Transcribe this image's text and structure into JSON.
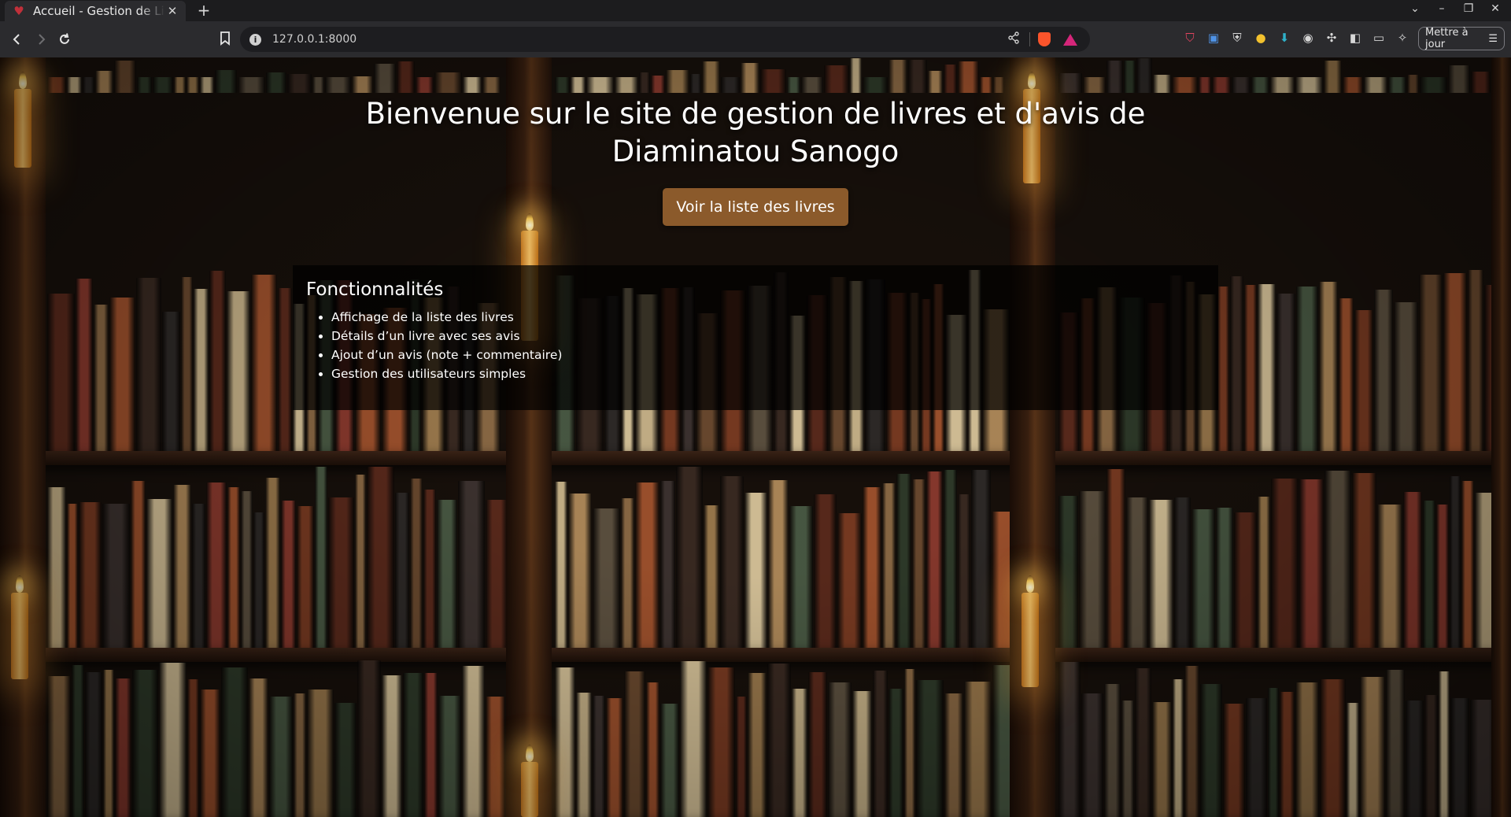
{
  "browser": {
    "tab_title": "Accueil - Gestion de Livres",
    "url": "127.0.0.1:8000",
    "update_label": "Mettre à jour",
    "accent_color": "#fb542b"
  },
  "page": {
    "heading": "Bienvenue sur le site de gestion de livres et d'avis de Diaminatou Sanogo",
    "cta_label": "Voir la liste des livres",
    "cta_color": "#8b5a2b",
    "features": {
      "title": "Fonctionnalités",
      "items": [
        "Affichage de la liste des livres",
        "Détails d’un livre avec ses avis",
        "Ajout d’un avis (note + commentaire)",
        "Gestion des utilisateurs simples"
      ]
    }
  }
}
